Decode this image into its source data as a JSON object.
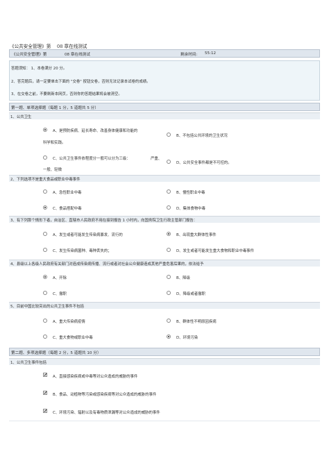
{
  "doc_title": "《公共安全管理》第　 08 章在线测试",
  "topbar": {
    "course": "《公共安全管理》第",
    "chapter": "08 章在线测试",
    "remaining_label": "剩余时间:",
    "remaining_value": "55:12"
  },
  "notice": {
    "line1": "答题须知：  1、本卷满分   20 分。",
    "line2": "2、答完题后，请一定要单击下面的  \"交卷\"  按钮交卷，否则无法记录本试卷的成绩。",
    "line3": "3、在交卷之前，不要刷新本网页，否则你的答题结果将会被清空。"
  },
  "section1": {
    "title": "第一题、单项选择题（每题     1 分，5 道题共   5 分）"
  },
  "q1": {
    "stem": "1、公共卫生",
    "a_l1": "A、是预防疾病、延长寿命、改善身体健康和功能的",
    "a_l2": "科学和实践。",
    "b": "B、不包括公共环境的卫生状况",
    "c_l1": "C、公共卫生事件依程度分一般可以分为三级：",
    "c_mid": "严重、",
    "c_l2": "一般、轻微",
    "d": "D、公共安全事件都是不可控的。"
  },
  "q2": {
    "stem": "2、下列选项不是重大食品或职业中毒事件",
    "a": "A、急性职业中毒",
    "b": "B、慢性职业中毒",
    "c": "C、食品搭配中毒",
    "d": "D、集体食物中毒"
  },
  "q3": {
    "stem": "3、有下列那个情形下者，自治区、直辖市人民政府不用在接到报告   1 小时内，向国务院卫生行政主管部门报告：",
    "a": "A、发生或者可能发生传染病暴发、流行的",
    "b": "B、出现重大群体性事件",
    "c": "C、发生传染病菌种、毒种丢失的；",
    "d": "D、发生或者可能发生重大食物和职业中毒事件"
  },
  "q4": {
    "stem": "4、县级以上各级人民政府有关部门对造成传染病传播、流行或者对社会公众健康造成其他严重危害后果的，依法给予",
    "a": "A、开除",
    "b": "B、降级",
    "c": "C、撤职",
    "d": "D、降级或者撤职"
  },
  "q5": {
    "stem": "5、目前中国比较突出的公共卫生事件不包括",
    "a": "A、重大传染病疫情",
    "b": "B、群体性不明原因疾病",
    "c": "C、重大食物或职业中毒",
    "d": "D、环境污染"
  },
  "section2": {
    "title": "第二题、多项选择题（每题     2 分，5 道题共   10 分）"
  },
  "m1": {
    "stem": "1、公共卫生事件包括",
    "a": "A、直接感染疾病或中毒等对公众造成的威胁的事件",
    "b": "B、食品、动植物等污染或感染疾病等对公众造成的威胁的事件",
    "c": "C、环境污染、辐射以及有毒物质泄漏等对公众造成的威胁的事件"
  }
}
